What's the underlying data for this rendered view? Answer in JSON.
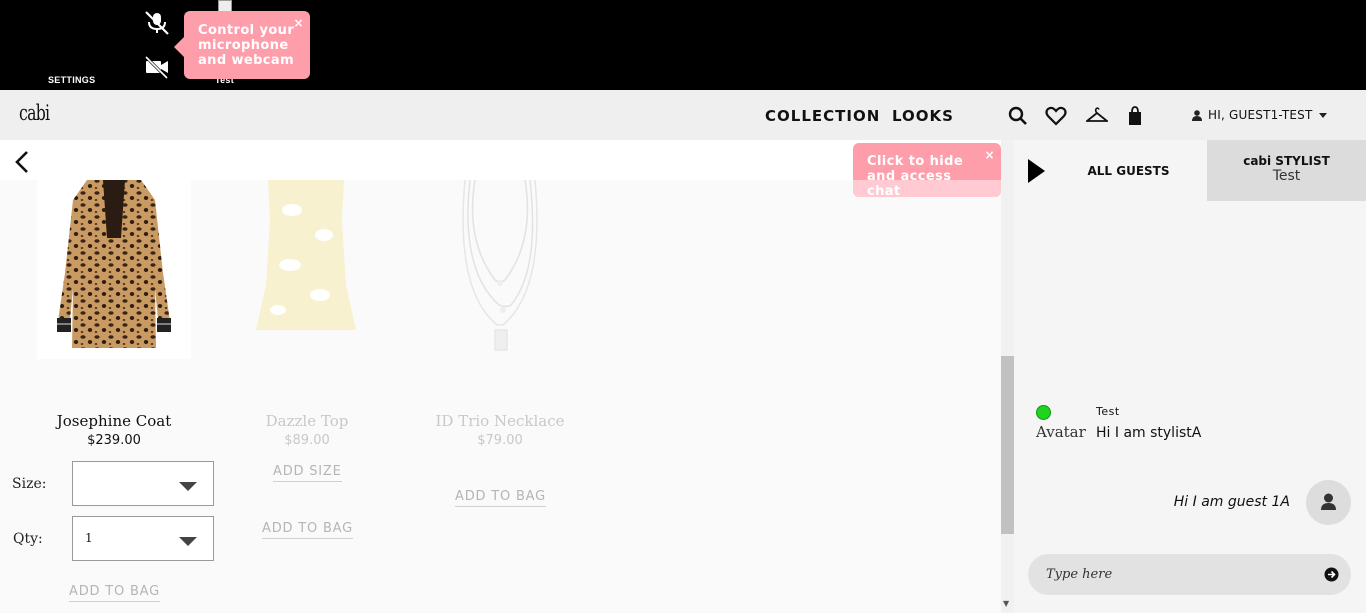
{
  "videobar": {
    "settings_label": "SETTINGS",
    "camera_label": "Test",
    "tooltip": "Control your microphone and webcam",
    "tooltip_close": "×"
  },
  "header": {
    "logo": "cabi",
    "nav": [
      "COLLECTION",
      "LOOKS"
    ],
    "icons": [
      "search-icon",
      "heart-icon",
      "hanger-icon",
      "shopping-bag-icon"
    ],
    "user_greeting": "HI, GUEST1-TEST"
  },
  "products": [
    {
      "name": "Josephine Coat",
      "price": "$239.00",
      "active": true,
      "size_label": "Size:",
      "size_value": "",
      "qty_label": "Qty:",
      "qty_value": "1",
      "add_to_bag": "ADD TO BAG"
    },
    {
      "name": "Dazzle Top",
      "price": "$89.00",
      "active": false,
      "add_size": "ADD SIZE",
      "add_to_bag": "ADD TO BAG"
    },
    {
      "name": "ID Trio Necklace",
      "price": "$79.00",
      "active": false,
      "add_to_bag": "ADD TO BAG"
    }
  ],
  "chat_tooltip": {
    "text": "Click to hide and access chat",
    "close": "×"
  },
  "chat": {
    "tabs": {
      "all_guests": "ALL GUESTS",
      "stylist_title": "cabi STYLIST",
      "stylist_name": "Test"
    },
    "messages": [
      {
        "sender": "Test",
        "avatar_alt": "Avatar",
        "text": "Hi I am stylistA",
        "status_color": "#1fd31f"
      },
      {
        "sender": "guest",
        "text": "Hi I am guest 1A"
      }
    ],
    "input_placeholder": "Type here"
  },
  "colors": {
    "tooltip": "#ff9eab",
    "header_bg": "#efefef",
    "online": "#1fd31f"
  }
}
